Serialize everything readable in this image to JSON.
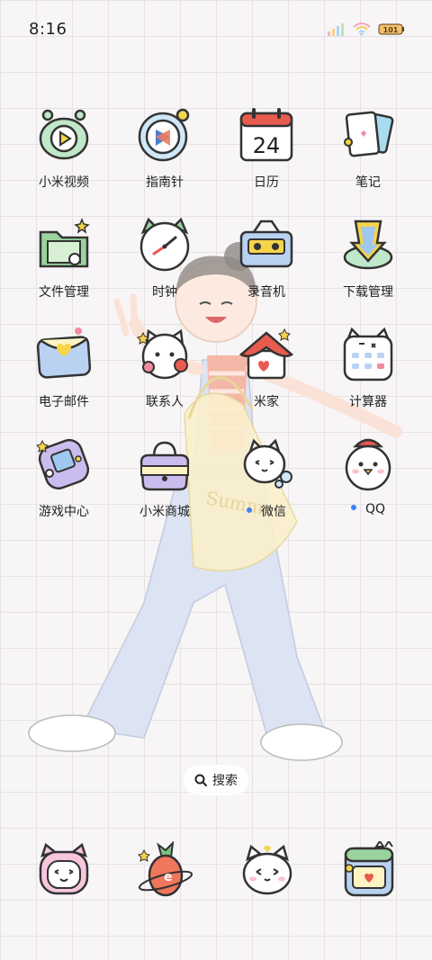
{
  "status_bar": {
    "time": "8:16",
    "battery_text": "101"
  },
  "apps": [
    {
      "label": "小米视频",
      "icon": "video-player-icon"
    },
    {
      "label": "指南针",
      "icon": "compass-icon"
    },
    {
      "label": "日历",
      "icon": "calendar-icon",
      "calendar_day": "24"
    },
    {
      "label": "笔记",
      "icon": "notes-icon"
    },
    {
      "label": "文件管理",
      "icon": "folder-icon"
    },
    {
      "label": "时钟",
      "icon": "clock-icon"
    },
    {
      "label": "录音机",
      "icon": "cassette-recorder-icon"
    },
    {
      "label": "下载管理",
      "icon": "download-icon"
    },
    {
      "label": "电子邮件",
      "icon": "envelope-icon"
    },
    {
      "label": "联系人",
      "icon": "contacts-cat-icon"
    },
    {
      "label": "米家",
      "icon": "home-icon"
    },
    {
      "label": "计算器",
      "icon": "calculator-icon"
    },
    {
      "label": "游戏中心",
      "icon": "gamepad-icon"
    },
    {
      "label": "小米商城",
      "icon": "shopping-bag-icon"
    },
    {
      "label": "微信",
      "icon": "wechat-cat-icon",
      "new_dot": true
    },
    {
      "label": "QQ",
      "icon": "qq-penguin-icon",
      "new_dot": true
    }
  ],
  "search": {
    "label": "搜索"
  },
  "dock": [
    {
      "icon": "pink-cat-phone-icon"
    },
    {
      "icon": "carrot-planet-icon"
    },
    {
      "icon": "white-cat-icon"
    },
    {
      "icon": "heart-box-icon"
    }
  ],
  "colors": {
    "accent_dot": "#3b82f6",
    "background": "#f7f5f6",
    "grid": "#e6e2e4"
  }
}
